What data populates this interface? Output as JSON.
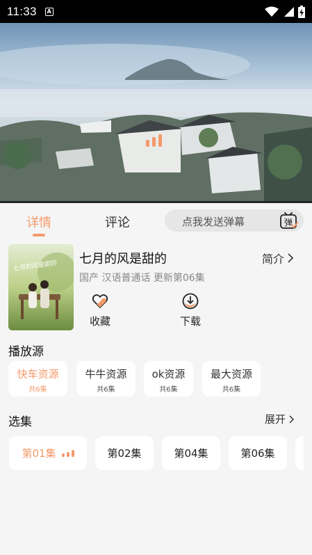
{
  "status_bar": {
    "time": "11:33",
    "a_badge": "A"
  },
  "tabs": {
    "details": "详情",
    "comments": "评论"
  },
  "danmaku": {
    "placeholder": "点我发送弹幕",
    "icon_label": "弹"
  },
  "show": {
    "title": "七月的风是甜的",
    "meta": "国产 汉语普通话 更新第06集",
    "intro_label": "简介",
    "poster_text": "七月的风是甜的"
  },
  "actions": {
    "favorite": "收藏",
    "download": "下载"
  },
  "sources": {
    "title": "播放源",
    "items": [
      {
        "name": "快车资源",
        "count": "共6集",
        "active": true
      },
      {
        "name": "牛牛资源",
        "count": "共6集",
        "active": false
      },
      {
        "name": "ok资源",
        "count": "共6集",
        "active": false
      },
      {
        "name": "最大资源",
        "count": "共6集",
        "active": false
      }
    ]
  },
  "episodes": {
    "title": "选集",
    "expand_label": "展开",
    "items": [
      {
        "label": "第01集",
        "active": true
      },
      {
        "label": "第02集",
        "active": false
      },
      {
        "label": "第04集",
        "active": false
      },
      {
        "label": "第06集",
        "active": false
      }
    ]
  },
  "colors": {
    "accent": "#f39a6b",
    "background": "#f5f5f5"
  }
}
